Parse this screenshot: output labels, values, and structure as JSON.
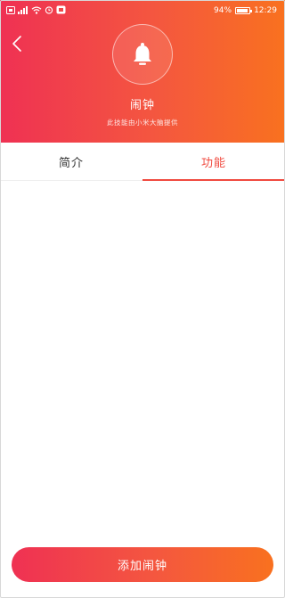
{
  "status_bar": {
    "battery_percent_text": "94%",
    "battery_level": 0.94,
    "time": "12:29"
  },
  "header": {
    "app_icon": "bell-icon",
    "app_name": "闹钟",
    "provider_note": "此技能由小米大脑提供",
    "colors": {
      "gradient_start": "#ef3153",
      "gradient_end": "#f9711f"
    }
  },
  "tabs": [
    {
      "label": "简介",
      "selected": false
    },
    {
      "label": "功能",
      "selected": true
    }
  ],
  "accent_color": "#f04a3f",
  "actions": {
    "add_label": "添加闹钟"
  }
}
